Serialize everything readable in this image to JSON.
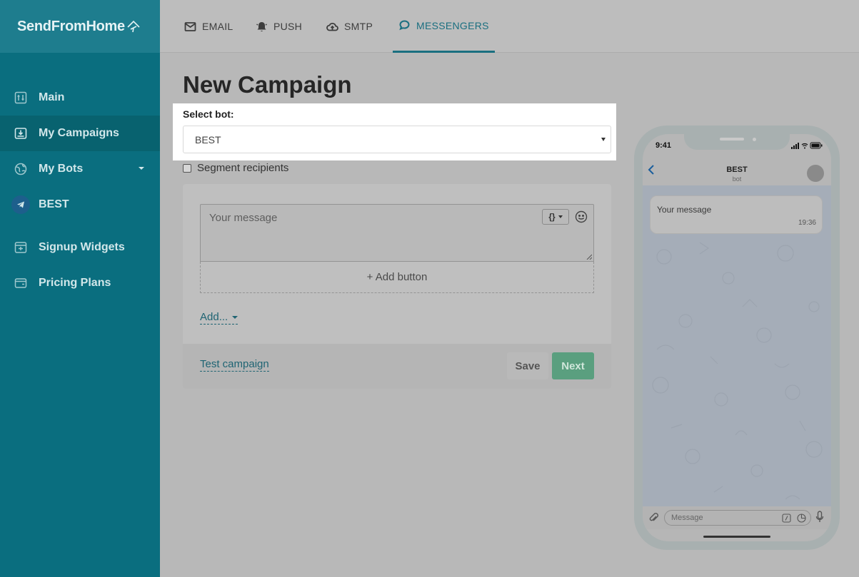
{
  "brand": {
    "name": "SendFromHome"
  },
  "sidebar": {
    "items": [
      {
        "label": "Main",
        "icon": "sliders-icon"
      },
      {
        "label": "My Campaigns",
        "icon": "campaign-icon"
      },
      {
        "label": "My Bots",
        "icon": "globe-icon"
      },
      {
        "label": "BEST",
        "icon": "telegram-icon"
      },
      {
        "label": "Signup Widgets",
        "icon": "widget-icon"
      },
      {
        "label": "Pricing Plans",
        "icon": "wallet-icon"
      }
    ]
  },
  "tabs": [
    {
      "label": "EMAIL",
      "icon": "envelope-icon"
    },
    {
      "label": "PUSH",
      "icon": "bell-icon"
    },
    {
      "label": "SMTP",
      "icon": "cloud-upload-icon"
    },
    {
      "label": "MESSENGERS",
      "icon": "chat-icon"
    }
  ],
  "main": {
    "title": "New Campaign",
    "select_label": "Select bot:",
    "selected_bot": "BEST",
    "segment_label": "Segment recipients",
    "message_placeholder": "Your message",
    "add_button_label": "+ Add button",
    "add_menu_label": "Add...",
    "test_link": "Test campaign",
    "save_label": "Save",
    "next_label": "Next"
  },
  "phone": {
    "time": "9:41",
    "chat_name": "BEST",
    "chat_sub": "bot",
    "bubble_text": "Your message",
    "bubble_time": "19:36",
    "input_placeholder": "Message"
  },
  "colors": {
    "sidebar": "#0a6e7f",
    "accent": "#1a6f80",
    "next_button": "#5a9f7f"
  }
}
